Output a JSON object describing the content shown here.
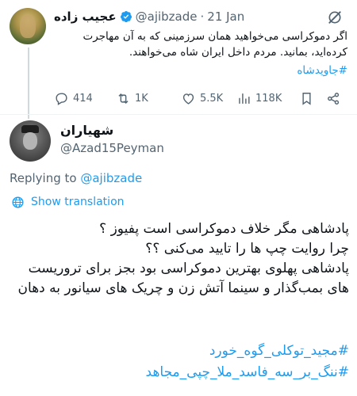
{
  "parent_tweet": {
    "author_name": "عجیب زاده",
    "handle": "@ajibzade",
    "separator": "·",
    "date": "21 Jan",
    "text": "اگر دموکراسی می‌خواهید همان سرزمینی که به آن مهاجرت کرده‌اید، بمانید. مردم داخل ایران شاه می‌خواهند.",
    "hashtag": "#جاویدشاه",
    "stats": {
      "replies": "414",
      "reposts": "1K",
      "likes": "5.5K",
      "views": "118K"
    },
    "icons": {
      "verified": "verified-badge-icon",
      "grok": "grok-icon",
      "reply": "reply-icon",
      "repost": "repost-icon",
      "like": "heart-icon",
      "views": "views-icon",
      "bookmark": "bookmark-icon",
      "share": "share-icon"
    }
  },
  "reply_tweet": {
    "author_name": "شهیاران",
    "handle": "@Azad15Peyman",
    "replying_to_label": "Replying to",
    "replying_to_handle": "@ajibzade",
    "show_translation": "Show translation",
    "lines": [
      "پادشاهی مگر خلاف دموکراسی است پفیوز ؟",
      "چرا روایت چپ ها را تایید می‌کنی ؟؟",
      "پادشاهی پهلوی بهترین دموکراسی بود بجز برای تروریست های بمب‌گذار و سینما آتش زن و چریک های سیانور به دهان"
    ],
    "hashtags": [
      "#مجید_توکلی_گوه_خورد",
      "#ننگ_بر_سه_فاسد_ملا_چپی_مجاهد"
    ]
  },
  "colors": {
    "accent": "#1d9bf0",
    "muted": "#536471",
    "text": "#0f1419",
    "divider": "#eff3f4"
  }
}
